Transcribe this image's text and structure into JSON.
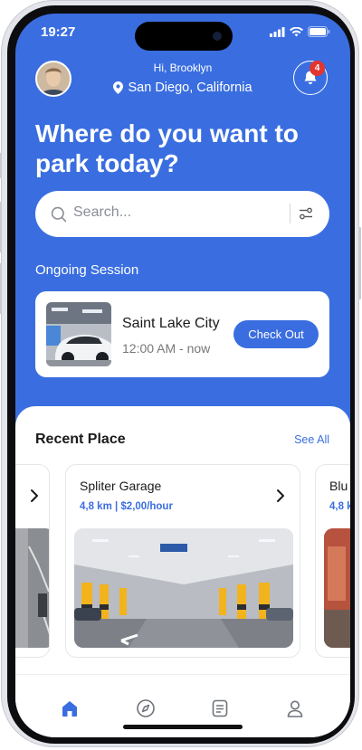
{
  "status_bar": {
    "time": "19:27"
  },
  "header": {
    "greeting": "Hi, Brooklyn",
    "location": "San Diego, California",
    "notification_count": "4"
  },
  "headline": "Where do you want to park today?",
  "search": {
    "placeholder": "Search..."
  },
  "ongoing_session": {
    "title": "Ongoing Session",
    "place": "Saint Lake City",
    "time": "12:00 AM - now",
    "action_label": "Check Out"
  },
  "recent": {
    "title": "Recent Place",
    "see_all_label": "See All",
    "places": [
      {
        "name": "Spliter Garage",
        "meta": "4,8 km | $2,00/hour"
      },
      {
        "name": "Blu",
        "meta": "4,8 k"
      }
    ]
  },
  "bottom_nav": {
    "items": [
      {
        "icon": "home-icon",
        "active": true
      },
      {
        "icon": "compass-icon",
        "active": false
      },
      {
        "icon": "document-icon",
        "active": false
      },
      {
        "icon": "profile-icon",
        "active": false
      }
    ]
  },
  "colors": {
    "accent": "#3a6ee0",
    "badge": "#e2352f",
    "background": "#3a6ee0",
    "card": "#ffffff"
  }
}
